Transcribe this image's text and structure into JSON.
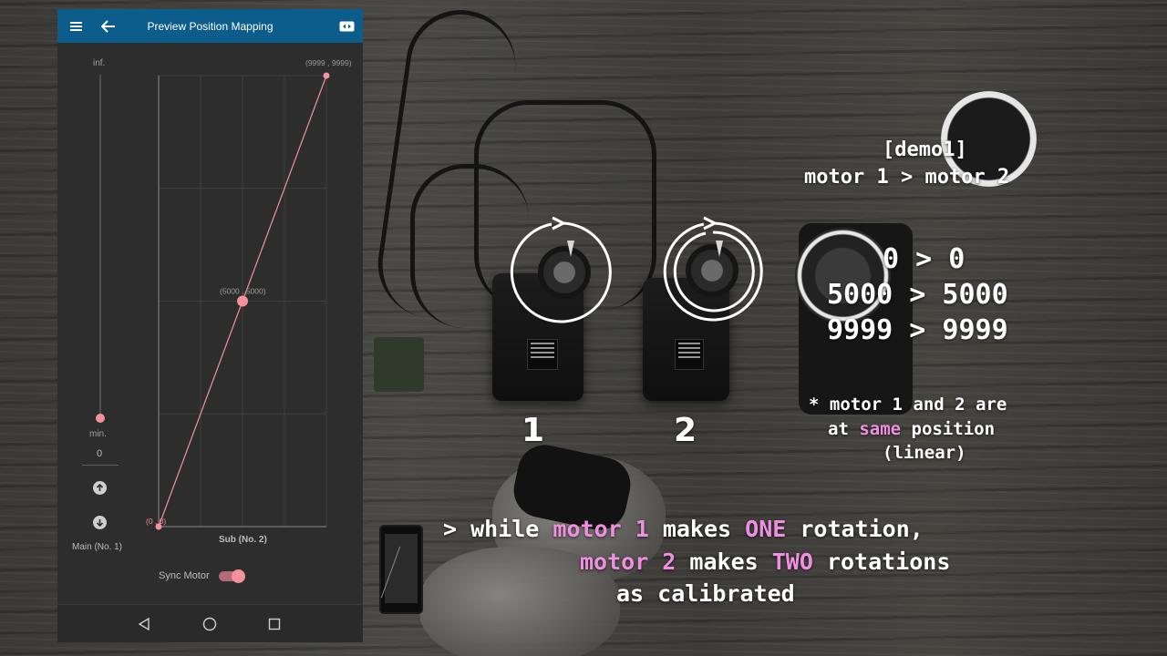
{
  "app": {
    "title": "Preview Position Mapping",
    "accent": "#0c5c8c",
    "point_color": "#f4919a",
    "icons": {
      "menu": "menu-icon",
      "back": "back-arrow-icon",
      "action": "swap-icon"
    }
  },
  "main_slider": {
    "top_label": "inf.",
    "bottom_label": "min.",
    "value": "0",
    "level": 0,
    "axis_label": "Main (No. 1)"
  },
  "chart_data": {
    "type": "line",
    "x": [
      0,
      5000,
      9999
    ],
    "y": [
      0,
      5000,
      9999
    ],
    "xlim": [
      0,
      9999
    ],
    "ylim": [
      0,
      9999
    ],
    "xlabel": "Sub (No. 2)",
    "grid": true,
    "point_labels": [
      "(0 , 0)",
      "(5000 , 5000)",
      "(9999 , 9999)"
    ]
  },
  "sync": {
    "label": "Sync Motor",
    "on": true
  },
  "nav": {
    "icons": [
      "back-triangle-icon",
      "home-circle-icon",
      "recents-square-icon"
    ]
  },
  "overlay": {
    "demo_title": "[demo1]",
    "demo_subtitle": "motor 1 > motor 2",
    "mapping": [
      "0 > 0",
      "5000 > 5000",
      "9999 > 9999"
    ],
    "note_prefix": "* motor 1 and 2 are",
    "note_at": "at ",
    "note_same": "same",
    "note_position": " position",
    "note_linear": "(linear)",
    "label_1": "1",
    "label_2": "2",
    "caption_l1_a": "> while ",
    "caption_l1_b": "motor 1",
    "caption_l1_c": " makes ",
    "caption_l1_d": "ONE",
    "caption_l1_e": " rotation,",
    "caption_l2_a": "motor 2",
    "caption_l2_b": " makes ",
    "caption_l2_c": "TWO",
    "caption_l2_d": " rotations",
    "caption_l3": "as calibrated",
    "highlight_color": "#ee8fe0"
  }
}
